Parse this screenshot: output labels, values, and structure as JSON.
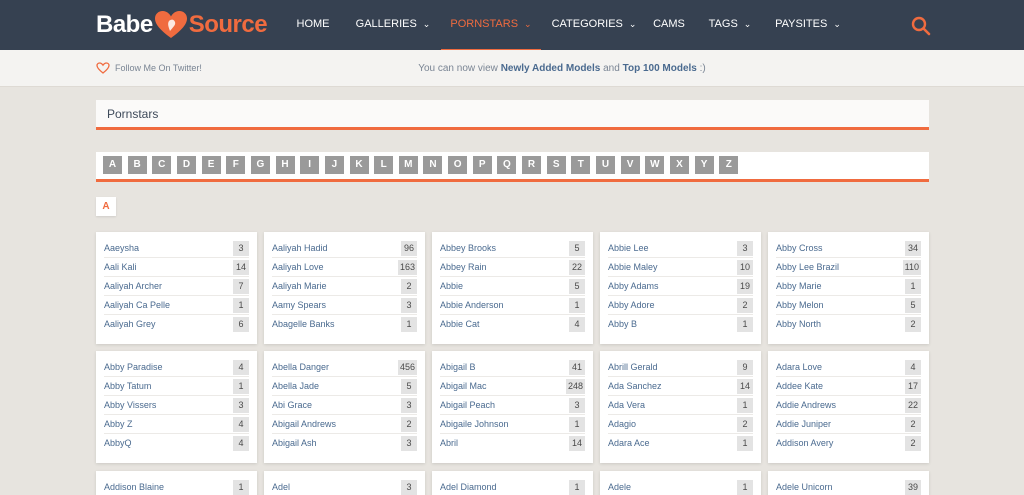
{
  "brand": {
    "part1": "Babe",
    "part2": "Source"
  },
  "nav": [
    {
      "label": "HOME",
      "dropdown": false,
      "active": false
    },
    {
      "label": "GALLERIES",
      "dropdown": true,
      "active": false
    },
    {
      "label": "PORNSTARS",
      "dropdown": true,
      "active": true
    },
    {
      "label": "CATEGORIES",
      "dropdown": true,
      "active": false
    },
    {
      "label": "CAMS",
      "dropdown": false,
      "active": false
    },
    {
      "label": "TAGS",
      "dropdown": true,
      "active": false
    },
    {
      "label": "PAYSITES",
      "dropdown": true,
      "active": false
    }
  ],
  "subbar": {
    "twitter": "Follow Me On Twitter!",
    "notice_prefix": "You can now view ",
    "notice_link1": "Newly Added Models",
    "notice_mid": " and ",
    "notice_link2": "Top 100 Models",
    "notice_suffix": " :)"
  },
  "page_title": "Pornstars",
  "alphabet": [
    "A",
    "B",
    "C",
    "D",
    "E",
    "F",
    "G",
    "H",
    "I",
    "J",
    "K",
    "L",
    "M",
    "N",
    "O",
    "P",
    "Q",
    "R",
    "S",
    "T",
    "U",
    "V",
    "W",
    "X",
    "Y",
    "Z"
  ],
  "section_letter": "A",
  "colors": {
    "accent": "#f06b3f",
    "header": "#364151",
    "link": "#4a6a8f"
  },
  "cards": [
    [
      [
        "Aaeysha",
        "3"
      ],
      [
        "Aali Kali",
        "14"
      ],
      [
        "Aaliyah Archer",
        "7"
      ],
      [
        "Aaliyah Ca Pelle",
        "1"
      ],
      [
        "Aaliyah Grey",
        "6"
      ]
    ],
    [
      [
        "Aaliyah Hadid",
        "96"
      ],
      [
        "Aaliyah Love",
        "163"
      ],
      [
        "Aaliyah Marie",
        "2"
      ],
      [
        "Aamy Spears",
        "3"
      ],
      [
        "Abagelle Banks",
        "1"
      ]
    ],
    [
      [
        "Abbey Brooks",
        "5"
      ],
      [
        "Abbey Rain",
        "22"
      ],
      [
        "Abbie",
        "5"
      ],
      [
        "Abbie Anderson",
        "1"
      ],
      [
        "Abbie Cat",
        "4"
      ]
    ],
    [
      [
        "Abbie Lee",
        "3"
      ],
      [
        "Abbie Maley",
        "10"
      ],
      [
        "Abby Adams",
        "19"
      ],
      [
        "Abby Adore",
        "2"
      ],
      [
        "Abby B",
        "1"
      ]
    ],
    [
      [
        "Abby Cross",
        "34"
      ],
      [
        "Abby Lee Brazil",
        "110"
      ],
      [
        "Abby Marie",
        "1"
      ],
      [
        "Abby Melon",
        "5"
      ],
      [
        "Abby North",
        "2"
      ]
    ],
    [
      [
        "Abby Paradise",
        "4"
      ],
      [
        "Abby Tatum",
        "1"
      ],
      [
        "Abby Vissers",
        "3"
      ],
      [
        "Abby Z",
        "4"
      ],
      [
        "AbbyQ",
        "4"
      ]
    ],
    [
      [
        "Abella Danger",
        "456"
      ],
      [
        "Abella Jade",
        "5"
      ],
      [
        "Abi Grace",
        "3"
      ],
      [
        "Abigail Andrews",
        "2"
      ],
      [
        "Abigail Ash",
        "3"
      ]
    ],
    [
      [
        "Abigail B",
        "41"
      ],
      [
        "Abigail Mac",
        "248"
      ],
      [
        "Abigail Peach",
        "3"
      ],
      [
        "Abigaile Johnson",
        "1"
      ],
      [
        "Abril",
        "14"
      ]
    ],
    [
      [
        "Abrill Gerald",
        "9"
      ],
      [
        "Ada Sanchez",
        "14"
      ],
      [
        "Ada Vera",
        "1"
      ],
      [
        "Adagio",
        "2"
      ],
      [
        "Adara Ace",
        "1"
      ]
    ],
    [
      [
        "Adara Love",
        "4"
      ],
      [
        "Addee Kate",
        "17"
      ],
      [
        "Addie Andrews",
        "22"
      ],
      [
        "Addie Juniper",
        "2"
      ],
      [
        "Addison Avery",
        "2"
      ]
    ],
    [
      [
        "Addison Blaine",
        "1"
      ]
    ],
    [
      [
        "Adel",
        "3"
      ]
    ],
    [
      [
        "Adel Diamond",
        "1"
      ]
    ],
    [
      [
        "Adele",
        "1"
      ]
    ],
    [
      [
        "Adele Unicorn",
        "39"
      ]
    ]
  ]
}
